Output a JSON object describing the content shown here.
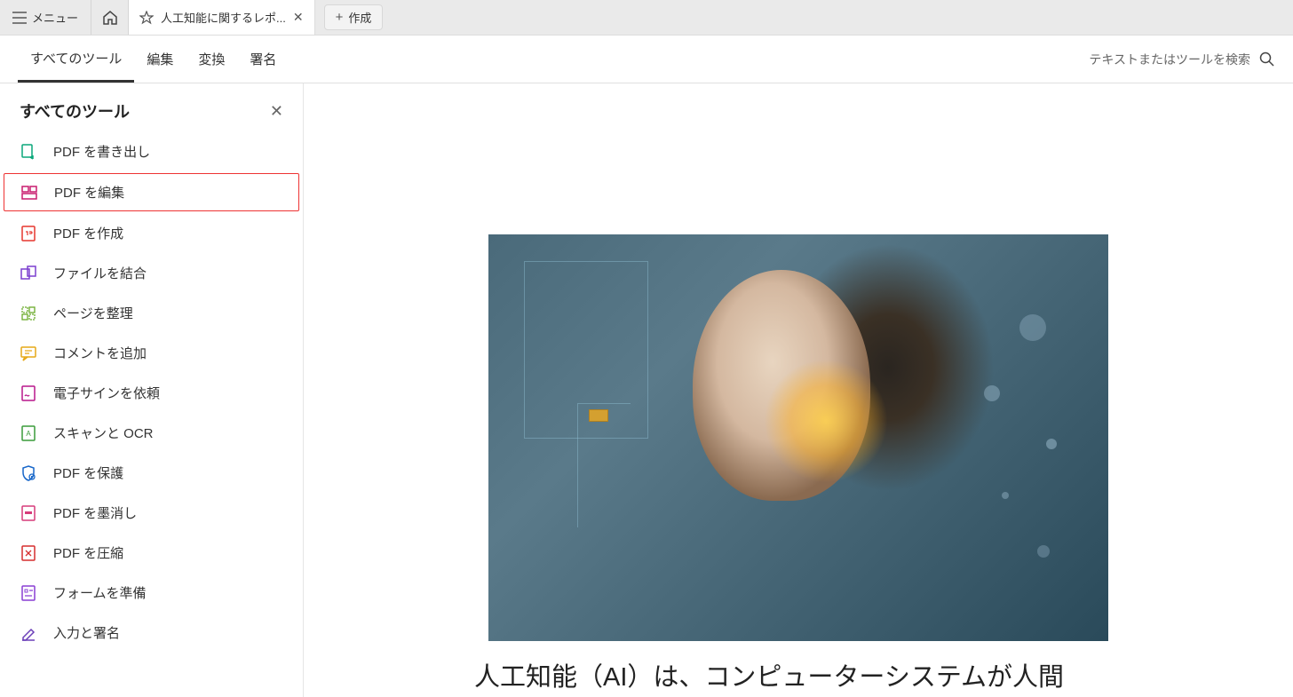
{
  "topbar": {
    "menu_label": "メニュー",
    "tab_title": "人工知能に関するレポ...",
    "create_label": "作成"
  },
  "navbar": {
    "items": [
      "すべてのツール",
      "編集",
      "変換",
      "署名"
    ],
    "search_placeholder": "テキストまたはツールを検索"
  },
  "sidebar": {
    "title": "すべてのツール",
    "tools": [
      {
        "label": "PDF を書き出し",
        "color": "#0aa77a"
      },
      {
        "label": "PDF を編集",
        "color": "#c91b6e"
      },
      {
        "label": "PDF を作成",
        "color": "#e6362e"
      },
      {
        "label": "ファイルを結合",
        "color": "#7b3fcf"
      },
      {
        "label": "ページを整理",
        "color": "#6aaa2a"
      },
      {
        "label": "コメントを追加",
        "color": "#e6a817"
      },
      {
        "label": "電子サインを依頼",
        "color": "#b8178b"
      },
      {
        "label": "スキャンと OCR",
        "color": "#3a9c3a"
      },
      {
        "label": "PDF を保護",
        "color": "#1766c9"
      },
      {
        "label": "PDF を墨消し",
        "color": "#d63b7a"
      },
      {
        "label": "PDF を圧縮",
        "color": "#d62e2e"
      },
      {
        "label": "フォームを準備",
        "color": "#8a3fd4"
      },
      {
        "label": "入力と署名",
        "color": "#6b3fb8"
      }
    ]
  },
  "document": {
    "body_text": "人工知能（AI）は、コンピューターシステムが人間"
  }
}
